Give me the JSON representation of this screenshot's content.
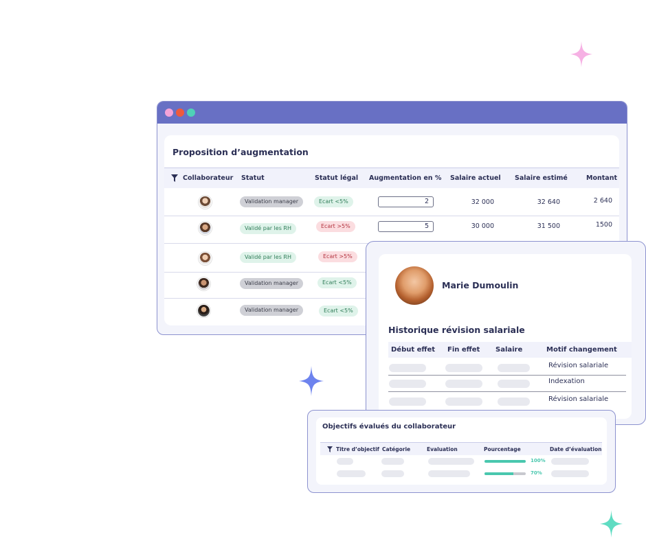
{
  "colors": {
    "window_bar": "#6870c4",
    "dot_pink": "#f4a3d8",
    "dot_red": "#ef5a3c",
    "dot_teal": "#4fd1b7",
    "sparkle_pink": "#f6b1e4",
    "sparkle_blue": "#6d83ee",
    "sparkle_teal": "#5fdcc2"
  },
  "main": {
    "title": "Proposition d’augmentation",
    "filter_icon": "filter-icon",
    "columns": [
      "Collaborateur",
      "Statut",
      "Statut légal",
      "Augmentation en %",
      "Salaire actuel",
      "Salaire estimé",
      "Montant"
    ],
    "rows": [
      {
        "statut": "Validation manager",
        "statut_style": "gray",
        "legal": "Ecart <5%",
        "legal_style": "green",
        "pct": "2",
        "salaire_actuel": "32 000",
        "salaire_estime": "32 640",
        "montant": "2 640"
      },
      {
        "statut": "Validé par les RH",
        "statut_style": "green",
        "legal": "Ecart >5%",
        "legal_style": "red",
        "pct": "5",
        "salaire_actuel": "30 000",
        "salaire_estime": "31 500",
        "montant": "1500"
      },
      {
        "statut": "Validé par les RH",
        "statut_style": "green",
        "legal": "Ecart >5%",
        "legal_style": "red"
      },
      {
        "statut": "Validation manager",
        "statut_style": "gray",
        "legal": "Ecart <5%",
        "legal_style": "green"
      },
      {
        "statut": "Validation manager",
        "statut_style": "gray",
        "legal": "Ecart <5%",
        "legal_style": "green"
      }
    ]
  },
  "history": {
    "name": "Marie Dumoulin",
    "title": "Historique révision salariale",
    "columns": [
      "Début effet",
      "Fin effet",
      "Salaire",
      "Motif changement"
    ],
    "motifs": [
      "Révision salariale",
      "Indexation",
      "Révision salariale"
    ]
  },
  "objectives": {
    "title": "Objectifs évalués du collaborateur",
    "columns": [
      "Titre d’objectif",
      "Catégorie",
      "Evaluation",
      "Pourcentage",
      "Date d’évaluation"
    ],
    "rows": [
      {
        "progress": 1.0,
        "label": "100%"
      },
      {
        "progress": 0.7,
        "label": "70%"
      }
    ]
  }
}
